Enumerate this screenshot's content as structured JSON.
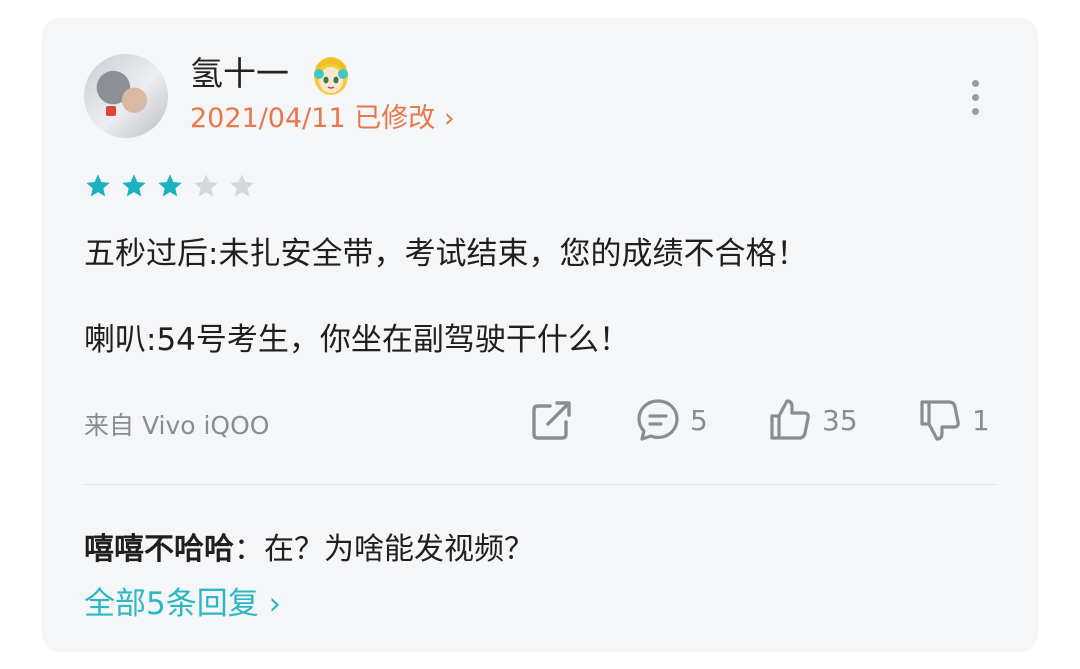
{
  "comment": {
    "username": "氢十一",
    "date": "2021/04/11",
    "edited_label": "已修改",
    "chevron": "›",
    "rating": {
      "value": 3,
      "max": 5,
      "filled_color": "#1bb3c2",
      "empty_color": "#d5d7db"
    },
    "body_lines": [
      "五秒过后:未扎安全带，考试结束，您的成绩不合格！",
      "喇叭:54号考生，你坐在副驾驶干什么！"
    ],
    "device": "来自 Vivo iQOO",
    "actions": {
      "share_icon": "share-icon",
      "comment_icon": "comment-icon",
      "comment_count": "5",
      "like_icon": "thumbs-up-icon",
      "like_count": "35",
      "dislike_icon": "thumbs-down-icon",
      "dislike_count": "1"
    }
  },
  "reply": {
    "name": "嘻嘻不哈哈",
    "separator": "：",
    "text": "在？为啥能发视频？"
  },
  "more_replies": {
    "label": "全部5条回复",
    "chevron": "›"
  },
  "colors": {
    "accent_orange": "#e8774b",
    "accent_teal": "#2bb8c4",
    "card_bg": "#f5f6f8"
  }
}
